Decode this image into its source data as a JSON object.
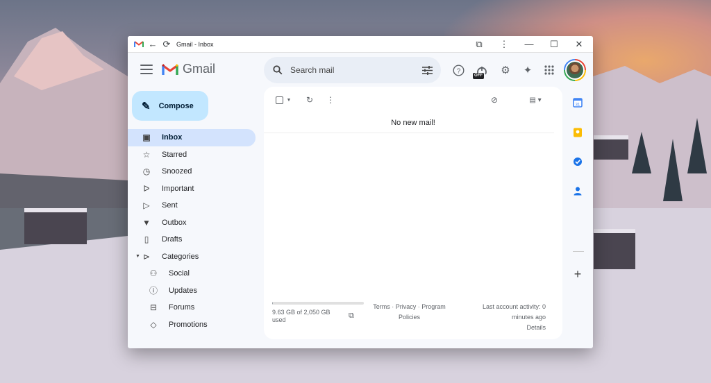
{
  "titlebar": {
    "title": "Gmail - Inbox",
    "icons": [
      "gmail-favicon",
      "back-icon",
      "reload-icon",
      "extensions-icon",
      "more-icon",
      "minimize-icon",
      "maximize-icon",
      "close-icon"
    ]
  },
  "header": {
    "logo_text": "Gmail",
    "search_placeholder": "Search mail",
    "gemini_badge": "OFF"
  },
  "compose": {
    "label": "Compose"
  },
  "nav": {
    "items": [
      {
        "label": "Inbox",
        "icon": "inbox-icon",
        "active": true
      },
      {
        "label": "Starred",
        "icon": "star-icon"
      },
      {
        "label": "Snoozed",
        "icon": "clock-icon"
      },
      {
        "label": "Important",
        "icon": "important-icon"
      },
      {
        "label": "Sent",
        "icon": "send-icon"
      },
      {
        "label": "Outbox",
        "icon": "outbox-icon"
      },
      {
        "label": "Drafts",
        "icon": "draft-icon"
      },
      {
        "label": "Categories",
        "icon": "label-icon"
      }
    ],
    "categories": [
      {
        "label": "Social",
        "icon": "people-icon"
      },
      {
        "label": "Updates",
        "icon": "info-icon"
      },
      {
        "label": "Forums",
        "icon": "forum-icon"
      },
      {
        "label": "Promotions",
        "icon": "tag-icon"
      }
    ]
  },
  "main": {
    "empty_message": "No new mail!",
    "storage": {
      "text": "9.63 GB of 2,050 GB used",
      "fraction": 0.005
    },
    "footer_links_line1": "Terms · Privacy · Program",
    "footer_links_line2": "Policies",
    "activity_line1": "Last account activity: 0",
    "activity_line2": "minutes ago",
    "details": "Details"
  },
  "colors": {
    "compose_bg": "#c2e7ff",
    "active_nav_bg": "#d3e3fd",
    "search_bg": "#e9eef6",
    "window_bg": "#f6f8fc"
  }
}
